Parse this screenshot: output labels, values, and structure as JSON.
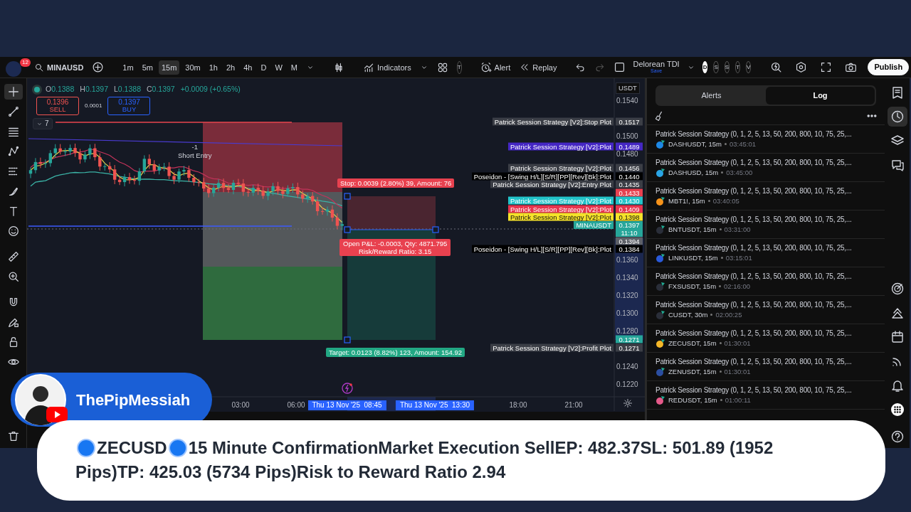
{
  "top_toolbar": {
    "notifications": "12",
    "symbol": "MINAUSD",
    "intervals": [
      {
        "label": "1m",
        "selected": false
      },
      {
        "label": "5m",
        "selected": false
      },
      {
        "label": "15m",
        "selected": true
      },
      {
        "label": "30m",
        "selected": false
      },
      {
        "label": "1h",
        "selected": false
      },
      {
        "label": "2h",
        "selected": false
      },
      {
        "label": "4h",
        "selected": false
      },
      {
        "label": "D",
        "selected": false
      },
      {
        "label": "W",
        "selected": false
      },
      {
        "label": "M",
        "selected": false
      }
    ],
    "indicators": "Indicators",
    "template": "T",
    "alert": "Alert",
    "replay": "Replay",
    "layout_name": "Delorean TDI",
    "layout_status": "Save",
    "profiles": [
      {
        "label": "D",
        "selected": true
      },
      {
        "label": "S",
        "selected": false
      },
      {
        "label": "S",
        "selected": false
      },
      {
        "label": "T",
        "selected": false
      },
      {
        "label": "V",
        "selected": false
      }
    ],
    "publish": "Publish"
  },
  "left_toolbar": {
    "tools": [
      {
        "selected": true
      },
      {
        "selected": false
      },
      {
        "selected": false
      },
      {
        "selected": false
      },
      {
        "selected": false
      },
      {
        "selected": false
      },
      {
        "selected": false
      },
      {
        "selected": false
      },
      {
        "selected": false
      },
      {
        "selected": false
      },
      {
        "selected": false
      },
      {
        "selected": false
      },
      {
        "selected": false
      },
      {
        "selected": false
      },
      {
        "selected": false
      }
    ]
  },
  "legend": {
    "ohlc": [
      {
        "key": "O",
        "value": "0.1388"
      },
      {
        "key": "H",
        "value": "0.1397"
      },
      {
        "key": "L",
        "value": "0.1388"
      },
      {
        "key": "C",
        "value": "0.1397"
      }
    ],
    "change": "+0.0009 (+0.65%)"
  },
  "trade": {
    "sell_price": "0.1396",
    "sell_label": "SELL",
    "spread": "0.0001",
    "buy_price": "0.1397",
    "buy_label": "BUY"
  },
  "indicators_toggle": "7",
  "chart": {
    "currency": "USDT",
    "price_ticks": [
      "0.1540",
      "0.1500",
      "0.1480",
      "0.1360",
      "0.1340",
      "0.1320",
      "0.1300",
      "0.1280",
      "0.1240",
      "0.1220"
    ],
    "price_tags": [
      {
        "label": "Patrick Session Strategy [V2]:Stop Plot",
        "value": "0.1517",
        "color": "#3b3e46"
      },
      {
        "label": "Patrick Session Strategy [V2]:Plot",
        "value": "0.1489",
        "color": "#4527c4"
      },
      {
        "label": "Patrick Session Strategy [V2]:Plot",
        "value": "0.1456",
        "color": "#3b3e46"
      },
      {
        "label": "Poseidon - [Swing H/L][S/R][PP][Rev][Bk]:Plot",
        "value": "0.1440",
        "color": "#000000"
      },
      {
        "label": "Patrick Session Strategy [V2]:Entry Plot",
        "value": "0.1435",
        "color": "#3b3e46"
      },
      {
        "value": "0.1433",
        "color": "#e8414f"
      },
      {
        "label": "Patrick Session Strategy [V2]:Plot",
        "value": "0.1430",
        "color": "#22c3c9"
      },
      {
        "label": "Patrick Session Strategy [V2]:Plot",
        "value": "0.1409",
        "color": "#e8344e"
      },
      {
        "label": "Patrick Session Strategy [V2]:Plot",
        "value": "0.1398",
        "color": "#f5e22a"
      },
      {
        "label": "MINAUSDT",
        "value": "0.1397",
        "time": "11:10",
        "color": "#26a69a"
      },
      {
        "value": "0.1394",
        "color": "#5d6068"
      },
      {
        "label": "Poseidon - [Swing H/L][S/R][PP][Rev][Bk]:Plot",
        "value": "0.1384",
        "color": "#000000"
      },
      {
        "value": "0.1271",
        "color": "#26a69a"
      },
      {
        "label": "Patrick Session Strategy [V2]:Profit Plot",
        "value": "0.1271",
        "color": "#3b3e46"
      }
    ],
    "entry_marker": "-1",
    "entry_text": "Short Entry",
    "stop_label": "Stop: 0.0039 (2.80%) 39, Amount: 76",
    "pnl_label": "Open P&L: -0.0003, Qty: 4871.795",
    "ratio_label": "Risk/Reward Ratio: 3.15",
    "target_label": "Target: 0.0123 (8.82%) 123, Amount: 154.92",
    "time_ticks": [
      {
        "label": "03:00",
        "highlighted": false
      },
      {
        "label": "06:00",
        "highlighted": false
      },
      {
        "label": "Thu 13 Nov '25  08:45",
        "highlighted": true
      },
      {
        "label": "Thu 13 Nov '25  13:30",
        "highlighted": true
      },
      {
        "label": "18:00",
        "highlighted": false
      },
      {
        "label": "21:00",
        "highlighted": false
      }
    ]
  },
  "right_panel": {
    "tabs": [
      {
        "label": "Alerts",
        "selected": false
      },
      {
        "label": "Log",
        "selected": true
      }
    ],
    "log": [
      {
        "title": "Patrick Session Strategy (0, 1, 2, 5, 13, 50, 200, 800, 10, 75, 25,...",
        "symbol": "DASHUSDT, 15m",
        "time": "03:45:01",
        "color": "#1e88e5"
      },
      {
        "title": "Patrick Session Strategy (0, 1, 2, 5, 13, 50, 200, 800, 10, 75, 25,...",
        "symbol": "DASHUSD, 15m",
        "time": "03:45:00",
        "color": "#2aa5e6"
      },
      {
        "title": "Patrick Session Strategy (0, 1, 2, 5, 13, 50, 200, 800, 10, 75, 25,...",
        "symbol": "MBT1!, 15m",
        "time": "03:40:05",
        "color": "#f7931a"
      },
      {
        "title": "Patrick Session Strategy (0, 1, 2, 5, 13, 50, 200, 800, 10, 75, 25,...",
        "symbol": "BNTUSDT, 15m",
        "time": "03:31:00",
        "color": "#2a2e39"
      },
      {
        "title": "Patrick Session Strategy (0, 1, 2, 5, 13, 50, 200, 800, 10, 75, 25,...",
        "symbol": "LINKUSDT, 15m",
        "time": "03:15:01",
        "color": "#2a5ada"
      },
      {
        "title": "Patrick Session Strategy (0, 1, 2, 5, 13, 50, 200, 800, 10, 75, 25,...",
        "symbol": "FXSUSDT, 15m",
        "time": "02:16:00",
        "color": "#2a2e39"
      },
      {
        "title": "Patrick Session Strategy (0, 1, 2, 5, 13, 50, 200, 800, 10, 75, 25,...",
        "symbol": "CUSDT, 30m",
        "time": "02:00:25",
        "color": "#2a2e39"
      },
      {
        "title": "Patrick Session Strategy (0, 1, 2, 5, 13, 50, 200, 800, 10, 75, 25,...",
        "symbol": "ZECUSDT, 15m",
        "time": "01:30:01",
        "color": "#f4b728"
      },
      {
        "title": "Patrick Session Strategy (0, 1, 2, 5, 13, 50, 200, 800, 10, 75, 25,...",
        "symbol": "ZENUSDT, 15m",
        "time": "01:30:01",
        "color": "#2b4ea0"
      },
      {
        "title": "Patrick Session Strategy (0, 1, 2, 5, 13, 50, 200, 800, 10, 75, 25,...",
        "symbol": "REDUSDT, 15m",
        "time": "01:00:11",
        "color": "#e65a8a"
      }
    ]
  },
  "right_toolbar": {
    "tools": [
      {
        "selected": false
      },
      {
        "selected": true
      },
      {
        "selected": false
      },
      {
        "selected": false
      },
      {
        "selected": false
      },
      {
        "selected": false
      },
      {
        "selected": false
      },
      {
        "selected": false
      },
      {
        "selected": false
      },
      {
        "selected": false
      },
      {
        "selected": false
      }
    ]
  },
  "channel": {
    "name": "ThePipMessiah"
  },
  "caption": {
    "lines": [
      {
        "segments": [
          {
            "kind": "dot"
          },
          {
            "kind": "text",
            "text": "ZECUSD"
          },
          {
            "kind": "dot"
          },
          {
            "kind": "text",
            "text": "15 Minute ConfirmationMarket Execution SellEP: 482.37SL: 501.89 (1952"
          }
        ]
      },
      {
        "segments": [
          {
            "kind": "text",
            "text": "Pips)TP: 425.03 (5734 Pips)Risk to Reward Ratio 2.94"
          }
        ]
      }
    ]
  }
}
